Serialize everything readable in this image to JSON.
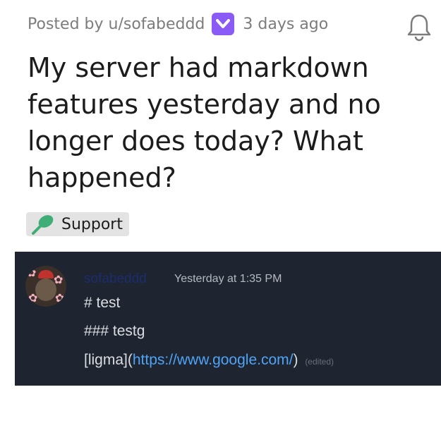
{
  "post": {
    "meta_prefix": "Posted by u/sofabeddd",
    "time_ago": "3 days ago",
    "title": "My server had markdown features yesterday and no longer does today? What happened?",
    "flair": "Support",
    "flair_icon": "leaf-icon",
    "badge_icon": "chevron-down-icon",
    "badge_color": "#8a5cf5"
  },
  "embed": {
    "username": "sofabeddd",
    "timestamp": "Yesterday at 1:35 PM",
    "lines": [
      "# test",
      "### testg"
    ],
    "link_line": {
      "prefix": "[ligma](",
      "url": "https://www.google.com/",
      "suffix": ")",
      "edited": "(edited)"
    },
    "link_color": "#4ea4f6",
    "background": "#1e2430"
  }
}
